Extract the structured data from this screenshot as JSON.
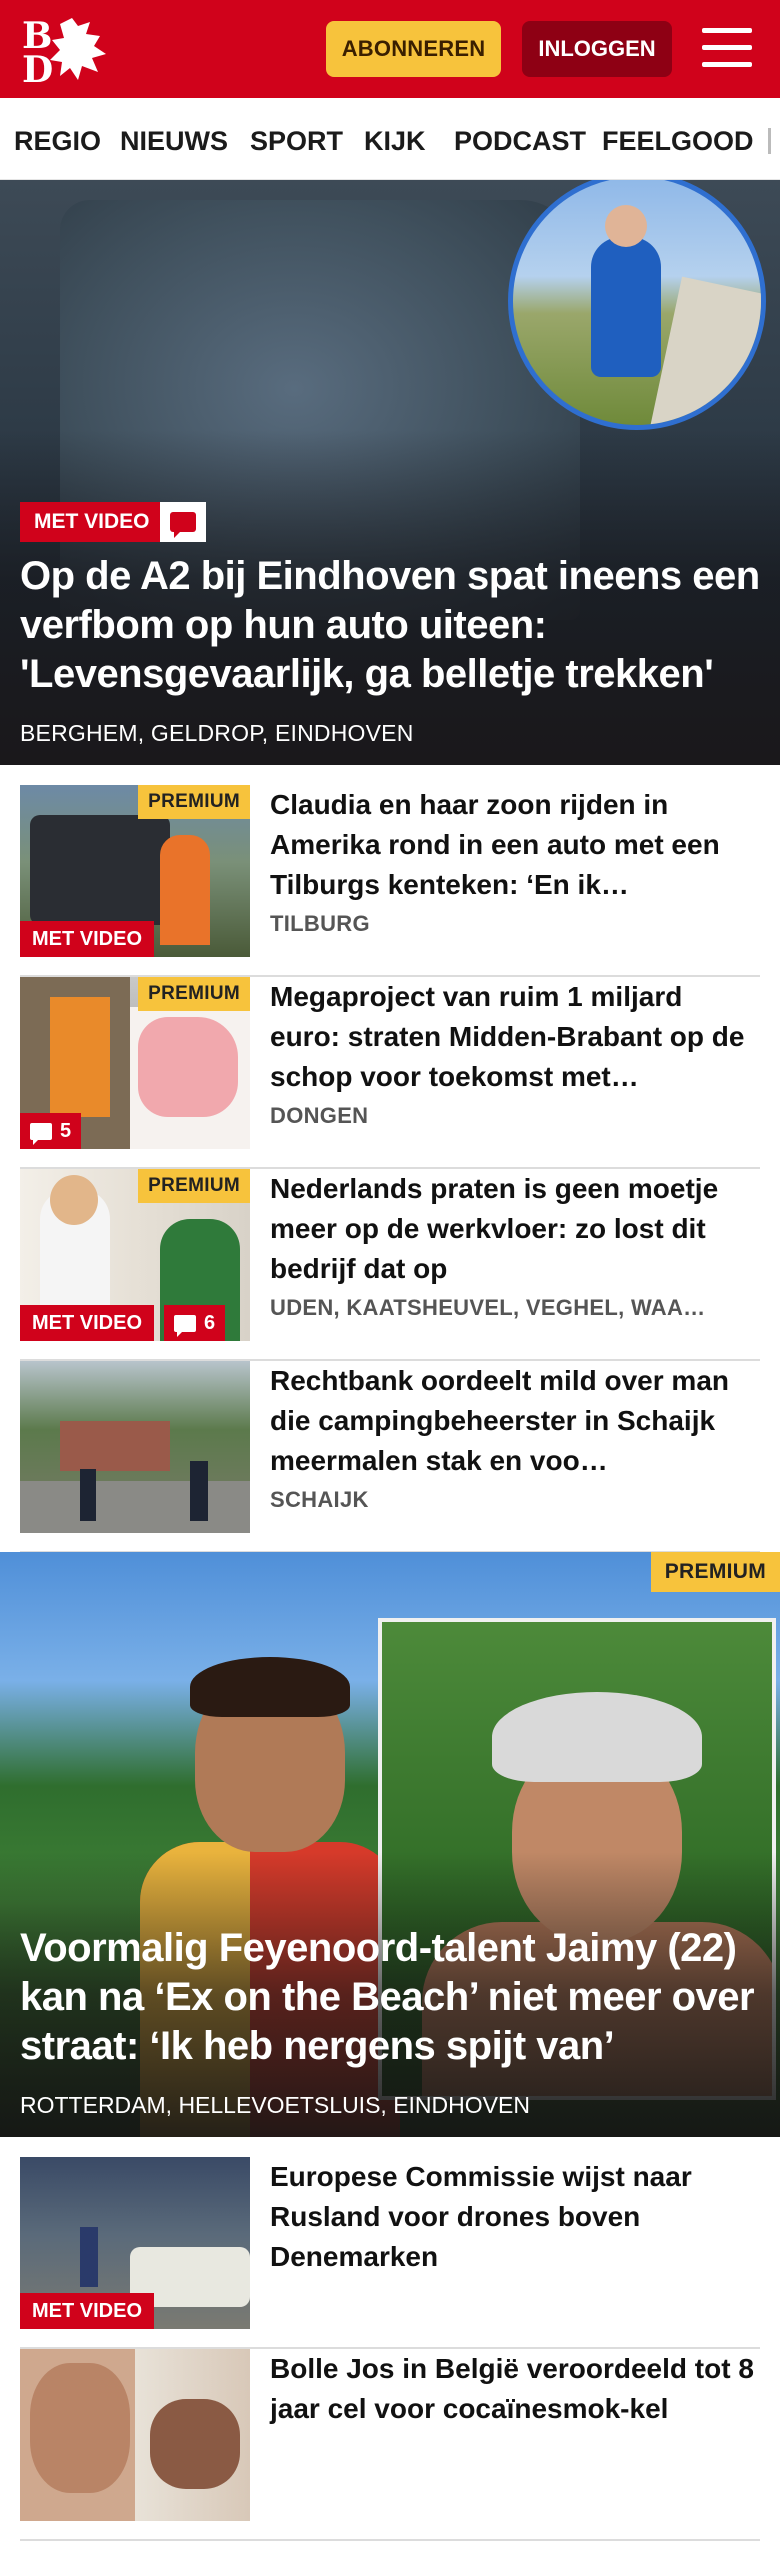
{
  "header": {
    "logo_text": "BD",
    "subscribe_label": "ABONNEREN",
    "login_label": "INLOGGEN",
    "brand_color": "#d0021b"
  },
  "nav": {
    "items": [
      "REGIO",
      "NIEUWS",
      "SPORT",
      "KIJK",
      "PODCAST",
      "FEELGOOD"
    ]
  },
  "hero": {
    "video_label": "MET VIDEO",
    "title": "Op de A2 bij Eindhoven spat ineens een verfbom op hun auto uiteen: 'Levensgevaarlijk, ga belletje trekken'",
    "locations": "BERGHEM, GELDROP, EINDHOVEN"
  },
  "articles": [
    {
      "title": "Claudia en haar zoon rijden in Amerika rond in een auto met een Tilburgs kenteken: ‘En ik…",
      "location": "TILBURG",
      "premium": "PREMIUM",
      "video": "MET VIDEO",
      "comments": ""
    },
    {
      "title": "Megaproject van ruim 1 miljard euro: straten Midden-Brabant op de schop voor toekomst met…",
      "location": "DONGEN",
      "premium": "PREMIUM",
      "video": "",
      "comments": "5"
    },
    {
      "title": "Nederlands praten is geen moetje meer op de werkvloer: zo lost dit bedrijf dat op",
      "location": "UDEN, KAATSHEUVEL, VEGHEL, WAA…",
      "premium": "PREMIUM",
      "video": "MET VIDEO",
      "comments": "6"
    },
    {
      "title": "Rechtbank oordeelt mild over man die campingbeheerster in Schaijk meermalen stak en voo…",
      "location": "SCHAIJK",
      "premium": "",
      "video": "",
      "comments": ""
    }
  ],
  "feature": {
    "premium": "PREMIUM",
    "title": "Voormalig Feyenoord-talent Jaimy (22) kan na ‘Ex on the Beach’ niet meer over straat: ‘Ik heb nergens spijt van’",
    "locations": "ROTTERDAM, HELLEVOETSLUIS, EINDHOVEN"
  },
  "articles2": [
    {
      "title": "Europese Commissie wijst naar Rusland voor drones boven Denemarken",
      "video": "MET VIDEO"
    },
    {
      "title": "Bolle Jos in België veroordeeld tot 8 jaar cel voor cocaïnesmok-kel",
      "video": ""
    }
  ],
  "icons": [
    "menu-icon",
    "comment-icon"
  ]
}
